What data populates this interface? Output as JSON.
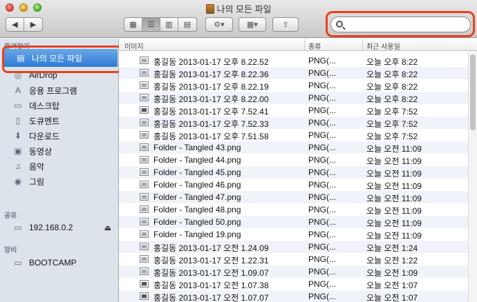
{
  "window": {
    "title": "나의 모든 파일"
  },
  "toolbar": {
    "back_glyph": "◀",
    "forward_glyph": "▶",
    "view_glyphs": [
      "▦",
      "☰",
      "▥",
      "▤"
    ],
    "action_glyph": "⚙▾",
    "arrange_glyph": "▦▾",
    "share_glyph": "⇪",
    "search_value": ""
  },
  "sidebar": {
    "favorites_title": "즐겨찾기",
    "favorites": [
      {
        "label": "나의 모든 파일",
        "icon": "all-files-icon",
        "glyph": "▤"
      },
      {
        "label": "AirDrop",
        "icon": "airdrop-icon",
        "glyph": "◎"
      },
      {
        "label": "응용 프로그램",
        "icon": "applications-icon",
        "glyph": "A"
      },
      {
        "label": "데스크탑",
        "icon": "desktop-icon",
        "glyph": "▭"
      },
      {
        "label": "도큐멘트",
        "icon": "documents-icon",
        "glyph": "▯"
      },
      {
        "label": "다운로드",
        "icon": "downloads-icon",
        "glyph": "⬇"
      },
      {
        "label": "동영상",
        "icon": "movies-icon",
        "glyph": "▣"
      },
      {
        "label": "음악",
        "icon": "music-icon",
        "glyph": "♫"
      },
      {
        "label": "그림",
        "icon": "pictures-icon",
        "glyph": "◉"
      }
    ],
    "shared_title": "공유",
    "shared": [
      {
        "label": "192.168.0.2",
        "icon": "computer-icon",
        "glyph": "▭",
        "eject": "⏏"
      }
    ],
    "devices_title": "장비",
    "devices": [
      {
        "label": "BOOTCAMP",
        "icon": "disk-icon",
        "glyph": "▭"
      }
    ]
  },
  "list": {
    "columns": {
      "name": "이미지",
      "kind": "종류",
      "date": "최근 사용일"
    },
    "rows": [
      {
        "name": "홍길동 2013-01-17 오후 8.22.52",
        "kind": "PNG(...",
        "date": "오늘 오후 8:22",
        "dark": false
      },
      {
        "name": "홍길동 2013-01-17 오후 8.22.36",
        "kind": "PNG(...",
        "date": "오늘 오후 8:22",
        "dark": false
      },
      {
        "name": "홍길동 2013-01-17 오후 8.22.19",
        "kind": "PNG(...",
        "date": "오늘 오후 8:22",
        "dark": false
      },
      {
        "name": "홍길동 2013-01-17 오후 8.22.00",
        "kind": "PNG(...",
        "date": "오늘 오후 8:22",
        "dark": false
      },
      {
        "name": "홍길동 2013-01-17 오후 7.52.41",
        "kind": "PNG(...",
        "date": "오늘 오후 7:52",
        "dark": true
      },
      {
        "name": "홍길동 2013-01-17 오후 7.52.33",
        "kind": "PNG(...",
        "date": "오늘 오후 7:52",
        "dark": false
      },
      {
        "name": "홍길동 2013-01-17 오후 7.51.58",
        "kind": "PNG(...",
        "date": "오늘 오후 7:52",
        "dark": false
      },
      {
        "name": "Folder - Tangled 43.png",
        "kind": "PNG(...",
        "date": "오늘 오전 11:09",
        "dark": false
      },
      {
        "name": "Folder - Tangled 44.png",
        "kind": "PNG(...",
        "date": "오늘 오전 11:09",
        "dark": false
      },
      {
        "name": "Folder - Tangled 45.png",
        "kind": "PNG(...",
        "date": "오늘 오전 11:09",
        "dark": false
      },
      {
        "name": "Folder - Tangled 46.png",
        "kind": "PNG(...",
        "date": "오늘 오전 11:09",
        "dark": false
      },
      {
        "name": "Folder - Tangled 47.png",
        "kind": "PNG(...",
        "date": "오늘 오전 11:09",
        "dark": false
      },
      {
        "name": "Folder - Tangled 48.png",
        "kind": "PNG(...",
        "date": "오늘 오전 11:09",
        "dark": false
      },
      {
        "name": "Folder - Tangled 50.png",
        "kind": "PNG(...",
        "date": "오늘 오전 11:09",
        "dark": false
      },
      {
        "name": "Folder - Tangled 19.png",
        "kind": "PNG(...",
        "date": "오늘 오전 11:09",
        "dark": false
      },
      {
        "name": "홍길동 2013-01-17 오전 1.24.09",
        "kind": "PNG(...",
        "date": "오늘 오전 1:24",
        "dark": false
      },
      {
        "name": "홍길동 2013-01-17 오전 1.22.31",
        "kind": "PNG(...",
        "date": "오늘 오전 1:22",
        "dark": false
      },
      {
        "name": "홍길동 2013-01-17 오전 1.09.07",
        "kind": "PNG(...",
        "date": "오늘 오전 1:09",
        "dark": false
      },
      {
        "name": "홍길동 2013-01-17 오전 1.07.38",
        "kind": "PNG(...",
        "date": "오늘 오전 1:07",
        "dark": true
      },
      {
        "name": "홍길동 2013-01-17 오전 1.07.07",
        "kind": "PNG(...",
        "date": "오늘 오전 1:07",
        "dark": true
      }
    ]
  }
}
